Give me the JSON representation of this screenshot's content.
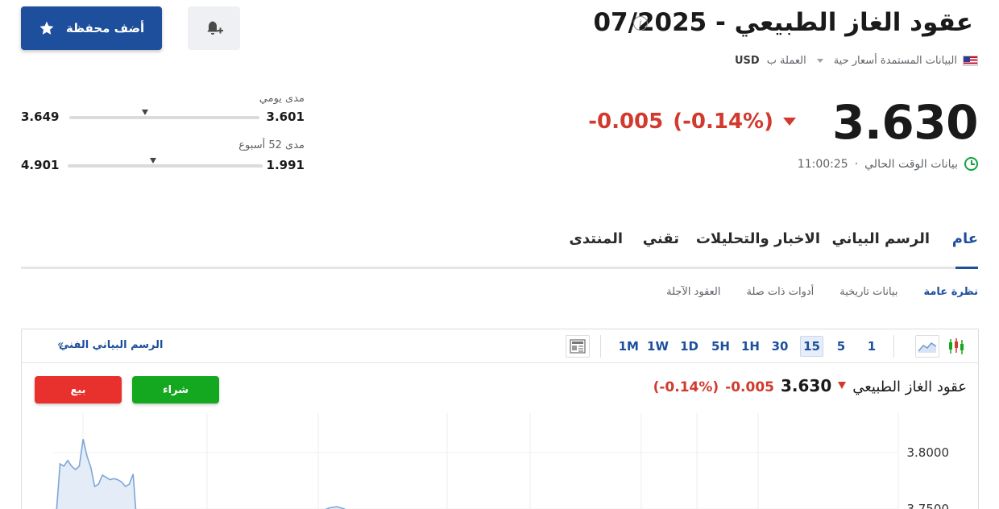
{
  "header": {
    "title": "عقود الغاز الطبيعي - 07/2025",
    "data_source": "البيانات المستمدة أسعار حية",
    "currency_label": "العملة ب",
    "currency_value": "USD",
    "portfolio_button": "أضف محفظة"
  },
  "quote": {
    "price": "3.630",
    "change": "-0.005",
    "change_pct": "(-0.14%)",
    "realtime_label": "بيانات الوقت الحالي",
    "time": "11:00:25",
    "direction": "down"
  },
  "ranges": {
    "daily": {
      "label": "مدى يومي",
      "low": "3.601",
      "high": "3.649",
      "current_fraction": 0.6
    },
    "week52": {
      "label": "مدى 52 أسبوع",
      "low": "1.991",
      "high": "4.901",
      "current_fraction": 0.56
    }
  },
  "tabs": [
    "عام",
    "الرسم البياني",
    "الاخبار والتحليلات",
    "تقني",
    "المنتدى"
  ],
  "active_tab": 0,
  "subtabs": [
    "نظرة عامة",
    "بيانات تاريخية",
    "أدوات ذات صلة",
    "العقود الآجلة"
  ],
  "active_subtab": 0,
  "chart_widget": {
    "timeframes": [
      "1",
      "5",
      "15",
      "30",
      "1H",
      "5H",
      "1D",
      "1W",
      "1M"
    ],
    "active_timeframe": "15",
    "technical_link": "الرسم البياني الفني",
    "technical_link_arrow": "»",
    "quote_name": "عقود الغاز الطبيعي",
    "quote_price": "3.630",
    "quote_change": "-0.005",
    "quote_change_pct": "(-0.14%)",
    "buy_label": "شراء",
    "sell_label": "بيع"
  },
  "colors": {
    "brand_blue": "#1d4f9c",
    "negative_red": "#d13a2e",
    "buy_green": "#13a81f",
    "sell_red": "#e8302c",
    "clock_green": "#12a33f"
  },
  "icons": {
    "portfolio_button_icon": "star-icon",
    "alert_button_icon": "bell-plus-icon",
    "info": "info-icon",
    "flag": "us-flag-icon",
    "clock": "clock-icon",
    "area_chart_tool": "area-chart-icon",
    "candle_tool": "candlestick-icon",
    "news_tool": "newspaper-icon"
  },
  "chart_data": {
    "type": "area",
    "y_ticks": [
      "3.8000",
      "3.7500"
    ],
    "ylim": [
      3.735,
      3.835
    ],
    "grid": true,
    "segments": [
      {
        "x": [
          0,
          1,
          2,
          3,
          4,
          5,
          6,
          7,
          8,
          9,
          10,
          11,
          12,
          13,
          14,
          15,
          16,
          17,
          18,
          19,
          20,
          21,
          22,
          23
        ],
        "values": [
          3.735,
          3.745,
          3.79,
          3.788,
          3.793,
          3.788,
          3.785,
          3.788,
          3.812,
          3.797,
          3.787,
          3.77,
          3.772,
          3.78,
          3.778,
          3.776,
          3.777,
          3.776,
          3.774,
          3.77,
          3.772,
          3.781,
          3.735,
          3.735
        ]
      },
      {
        "x": [
          68,
          70,
          72,
          74,
          76,
          78
        ],
        "values": [
          3.735,
          3.748,
          3.751,
          3.752,
          3.75,
          3.735
        ]
      }
    ],
    "x_max": 220
  }
}
